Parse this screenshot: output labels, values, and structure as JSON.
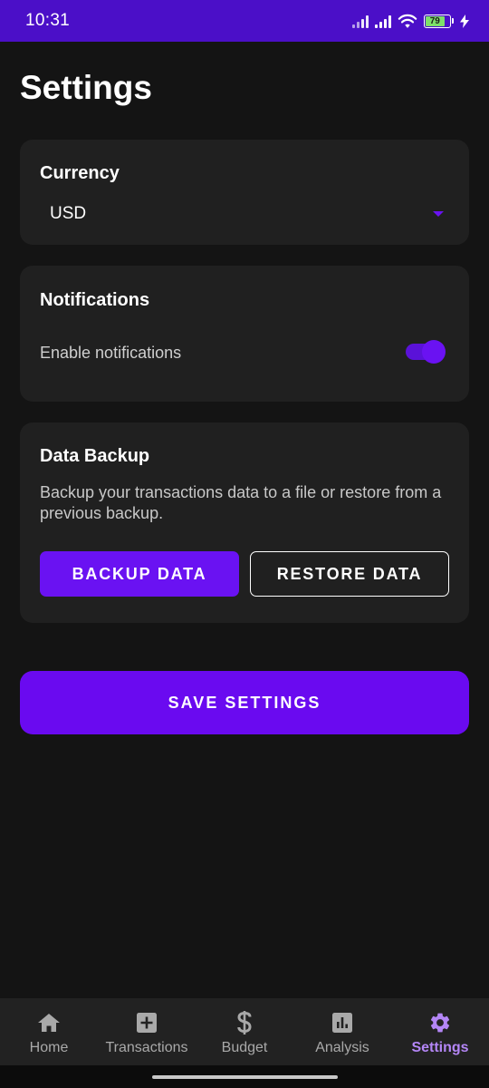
{
  "status_bar": {
    "time": "10:31",
    "battery_level": "79",
    "battery_fraction": 0.79,
    "icons": [
      "signal-icon",
      "signal-icon",
      "wifi-icon",
      "battery-icon",
      "charging-icon"
    ]
  },
  "page": {
    "title": "Settings"
  },
  "currency": {
    "title": "Currency",
    "selected": "USD"
  },
  "notifications": {
    "title": "Notifications",
    "label": "Enable notifications",
    "enabled": true
  },
  "backup": {
    "title": "Data Backup",
    "description": "Backup your transactions data to a file or restore from a previous backup.",
    "backup_label": "BACKUP DATA",
    "restore_label": "RESTORE DATA"
  },
  "save": {
    "label": "SAVE SETTINGS"
  },
  "nav": {
    "items": [
      {
        "label": "Home",
        "icon": "home-icon"
      },
      {
        "label": "Transactions",
        "icon": "add-box-icon"
      },
      {
        "label": "Budget",
        "icon": "dollar-icon"
      },
      {
        "label": "Analysis",
        "icon": "bar-chart-icon"
      },
      {
        "label": "Settings",
        "icon": "gear-icon"
      }
    ],
    "active": "Settings"
  },
  "colors": {
    "accent": "#6a12f2",
    "status_bar": "#4b0fc8",
    "background": "#141414",
    "card": "#202020",
    "active_nav": "#b486f6"
  }
}
